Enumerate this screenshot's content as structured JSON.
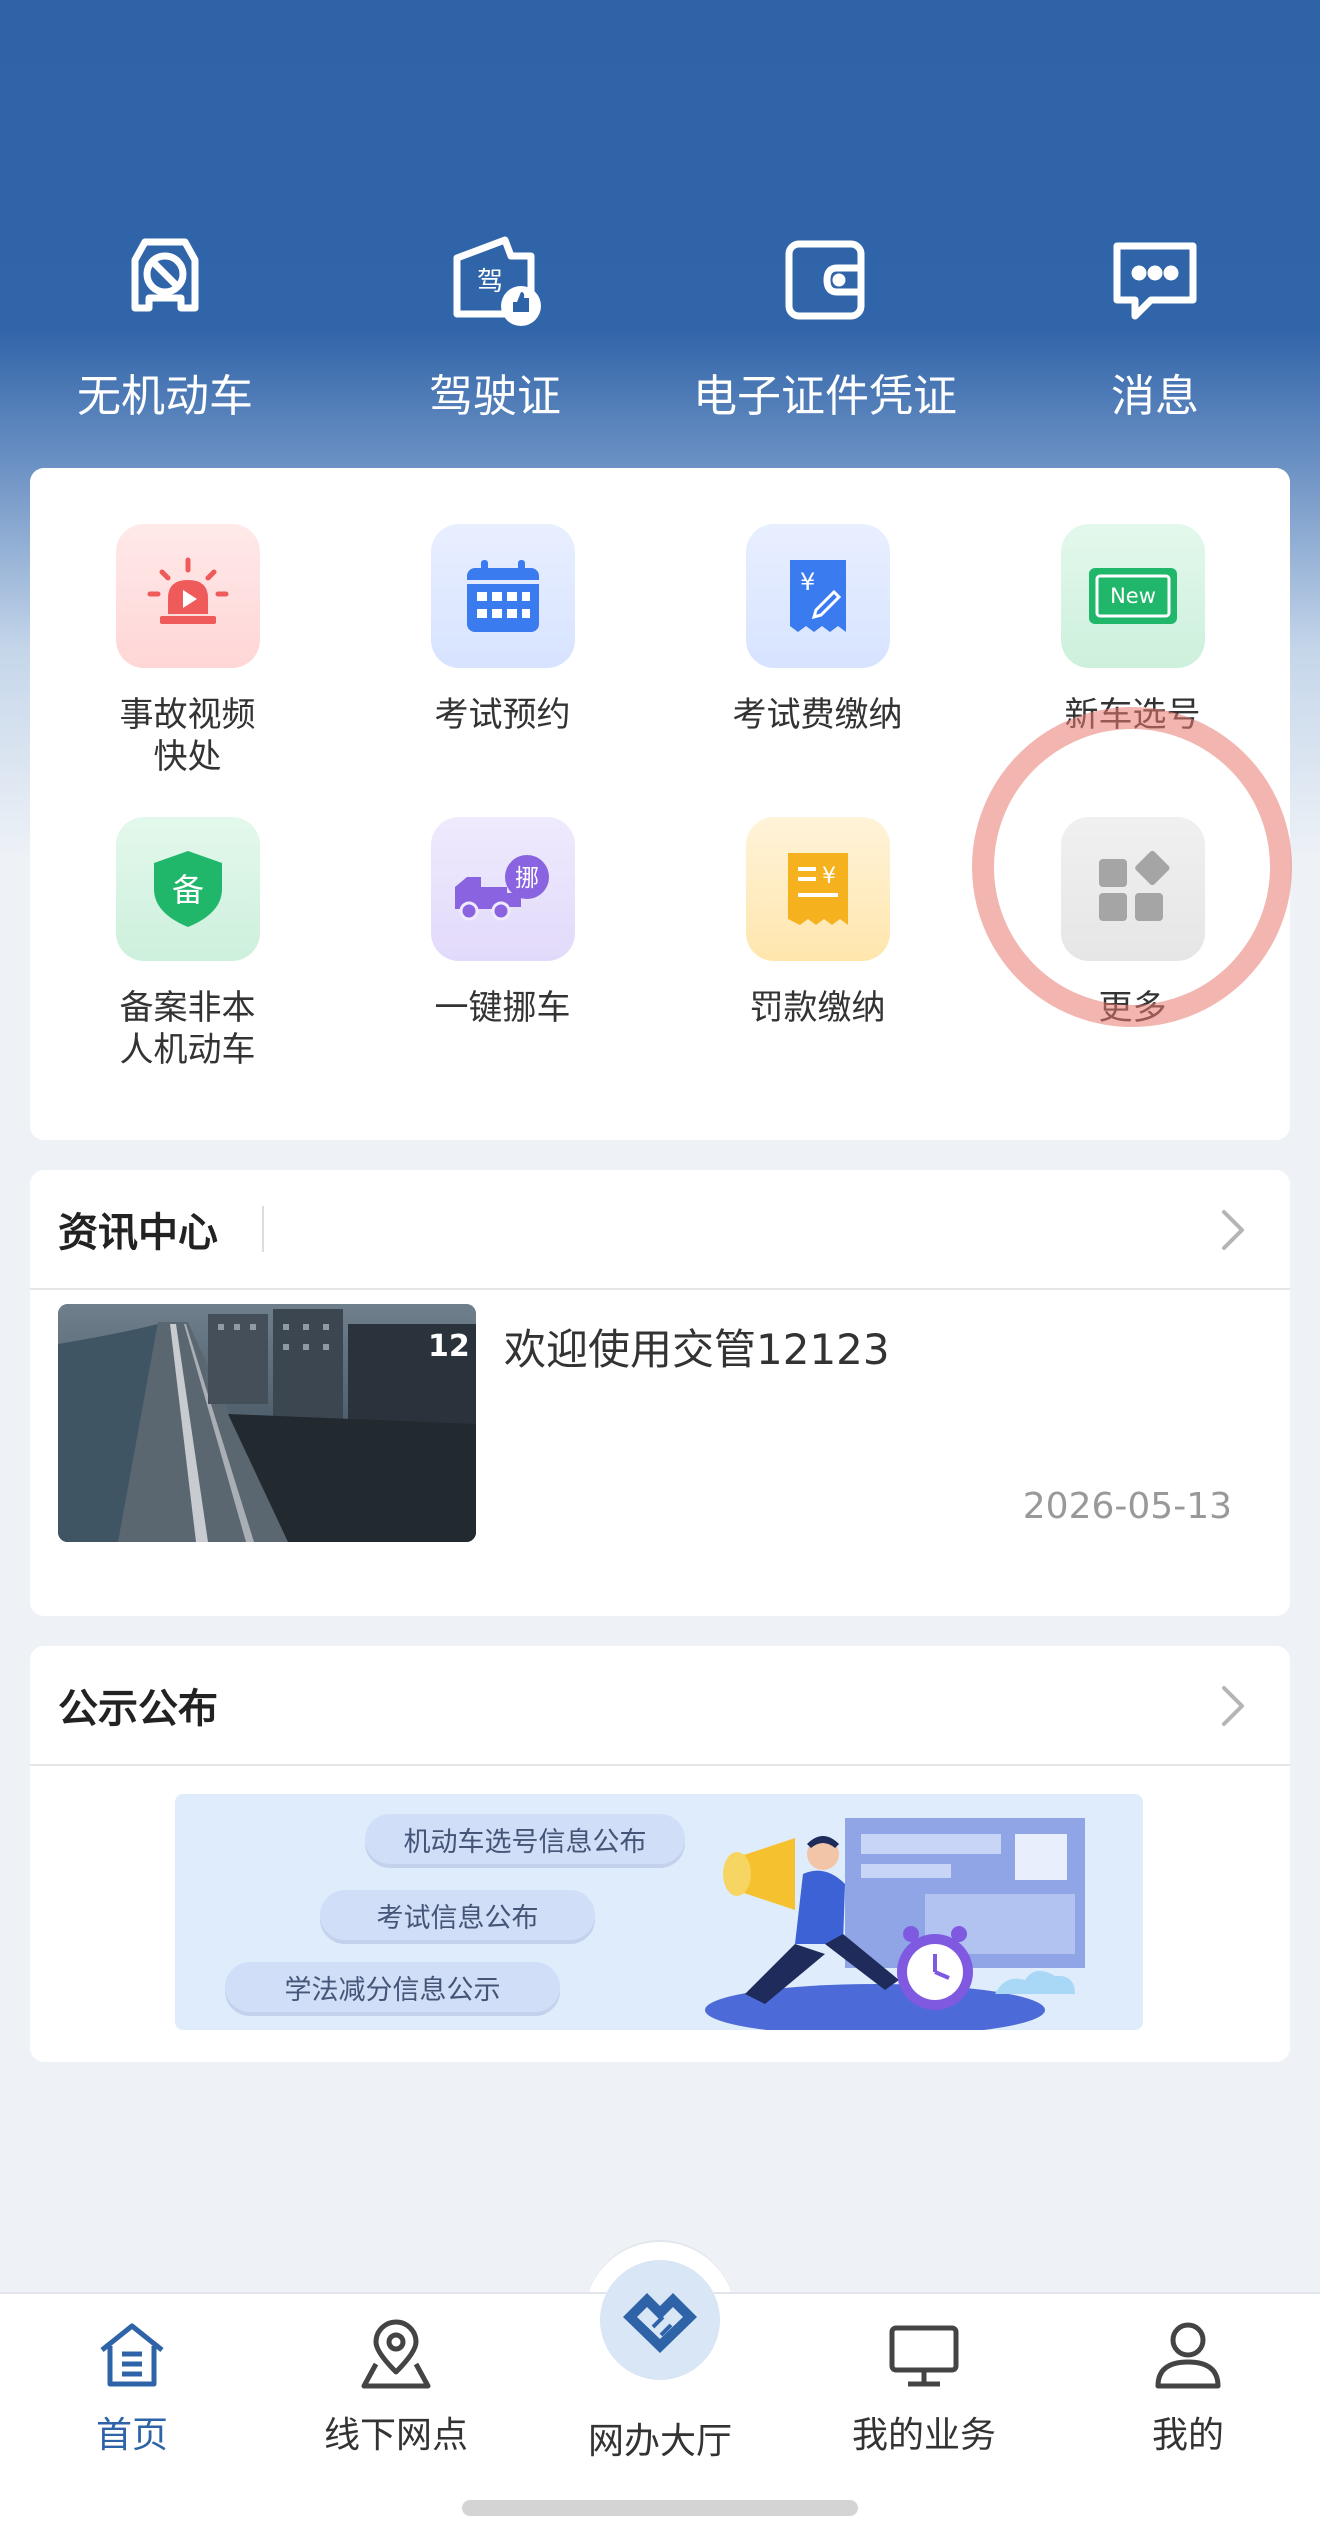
{
  "top_nav": {
    "items": [
      {
        "label": "无机动车",
        "icon": "no-car-icon"
      },
      {
        "label": "驾驶证",
        "icon": "license-thumb-icon"
      },
      {
        "label": "电子证件凭证",
        "icon": "wallet-icon"
      },
      {
        "label": "消息",
        "icon": "message-icon"
      }
    ]
  },
  "services": {
    "items": [
      {
        "label_lines": [
          "事故视频",
          "快处"
        ],
        "icon": "alarm-light-icon"
      },
      {
        "label_lines": [
          "考试预约"
        ],
        "icon": "calendar-icon"
      },
      {
        "label_lines": [
          "考试费缴纳"
        ],
        "icon": "fee-receipt-icon"
      },
      {
        "label_lines": [
          "新车选号"
        ],
        "icon": "new-plate-icon"
      },
      {
        "label_lines": [
          "备案非本",
          "人机动车"
        ],
        "icon": "shield-icon",
        "icon_text": "备"
      },
      {
        "label_lines": [
          "一键挪车"
        ],
        "icon": "truck-icon",
        "icon_text": "挪"
      },
      {
        "label_lines": [
          "罚款缴纳"
        ],
        "icon": "fine-receipt-icon"
      },
      {
        "label_lines": [
          "更多"
        ],
        "icon": "more-grid-icon"
      }
    ]
  },
  "news": {
    "title": "资讯中心",
    "article": {
      "title": "欢迎使用交管12123",
      "date": "2026-05-13",
      "thumb_text": "12"
    }
  },
  "notices": {
    "title": "公示公布",
    "pills": [
      "机动车选号信息公布",
      "考试信息公布",
      "学法减分信息公示"
    ]
  },
  "tabbar": {
    "items": [
      {
        "label": "首页",
        "icon": "home-icon",
        "active": true
      },
      {
        "label": "线下网点",
        "icon": "map-pin-icon",
        "active": false
      },
      {
        "label": "网办大厅",
        "icon": "hall-icon",
        "active": false
      },
      {
        "label": "我的业务",
        "icon": "monitor-icon",
        "active": false
      },
      {
        "label": "我的",
        "icon": "user-icon",
        "active": false
      }
    ]
  },
  "colors": {
    "header_blue": "#2f63a8",
    "active_tab": "#2f63a8",
    "ring": "#e8786e"
  }
}
